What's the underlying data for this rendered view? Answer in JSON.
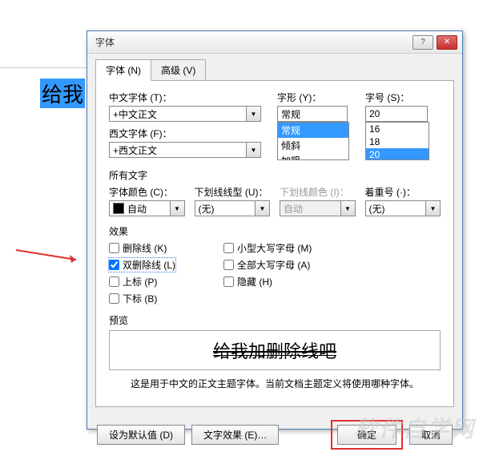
{
  "document": {
    "selected_text": "给我"
  },
  "dialog": {
    "title": "字体",
    "help_btn": "?",
    "close_btn": "✕",
    "tabs": {
      "font": "字体 (N)",
      "advanced": "高级 (V)"
    },
    "chinese_font": {
      "label": "中文字体 (T)：",
      "value": "+中文正文"
    },
    "western_font": {
      "label": "西文字体 (F)：",
      "value": "+西文正文"
    },
    "font_style": {
      "label": "字形 (Y)：",
      "value": "常规",
      "options": [
        "常规",
        "倾斜",
        "加粗"
      ]
    },
    "font_size": {
      "label": "字号 (S)：",
      "value": "20",
      "options": [
        "16",
        "18",
        "20"
      ]
    },
    "all_text_label": "所有文字",
    "font_color": {
      "label": "字体颜色 (C)：",
      "value": "自动"
    },
    "underline_style": {
      "label": "下划线线型 (U)：",
      "value": "(无)"
    },
    "underline_color": {
      "label": "下划线颜色 (I)：",
      "value": "自动"
    },
    "emphasis": {
      "label": "着重号 (·)：",
      "value": "(无)"
    },
    "effects_label": "效果",
    "effects": {
      "strikethrough": "删除线 (K)",
      "double_strikethrough": "双删除线 (L)",
      "superscript": "上标 (P)",
      "subscript": "下标 (B)",
      "smallcaps": "小型大写字母 (M)",
      "allcaps": "全部大写字母 (A)",
      "hidden": "隐藏 (H)"
    },
    "checked": {
      "strikethrough": false,
      "double_strikethrough": true,
      "superscript": false,
      "subscript": false,
      "smallcaps": false,
      "allcaps": false,
      "hidden": false
    },
    "preview_label": "预览",
    "preview_text": "给我加删除线吧",
    "preview_note": "这是用于中文的正文主题字体。当前文档主题定义将使用哪种字体。",
    "buttons": {
      "default": "设为默认值 (D)",
      "text_effects": "文字效果 (E)…",
      "ok": "确定",
      "cancel": "取消"
    }
  },
  "watermark": "软件自学网"
}
